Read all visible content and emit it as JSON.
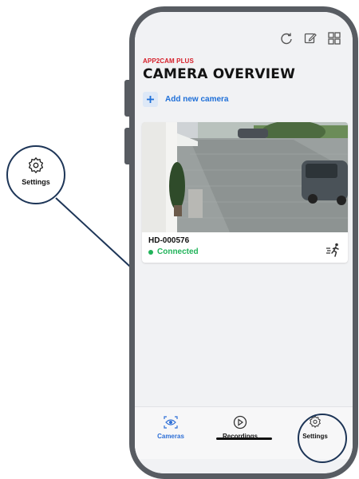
{
  "app": {
    "brand": "APP2CAM PLUS",
    "page_title": "CAMERA OVERVIEW",
    "add_camera_label": "Add new camera"
  },
  "camera": {
    "name": "HD-000576",
    "status": "Connected",
    "status_color": "#21b35a"
  },
  "tabbar": {
    "cameras_label": "Cameras",
    "recordings_label": "Recordings",
    "settings_label": "Settings"
  },
  "callout": {
    "label": "Settings",
    "icon": "gear-icon"
  },
  "icons": {
    "top": [
      "refresh-icon",
      "edit-icon",
      "grid-icon"
    ],
    "motion": "motion-detection-icon"
  },
  "colors": {
    "brand_red": "#d6202a",
    "accent_blue": "#1e6fd8",
    "connected_green": "#21b35a",
    "callout_navy": "#1d3557"
  }
}
